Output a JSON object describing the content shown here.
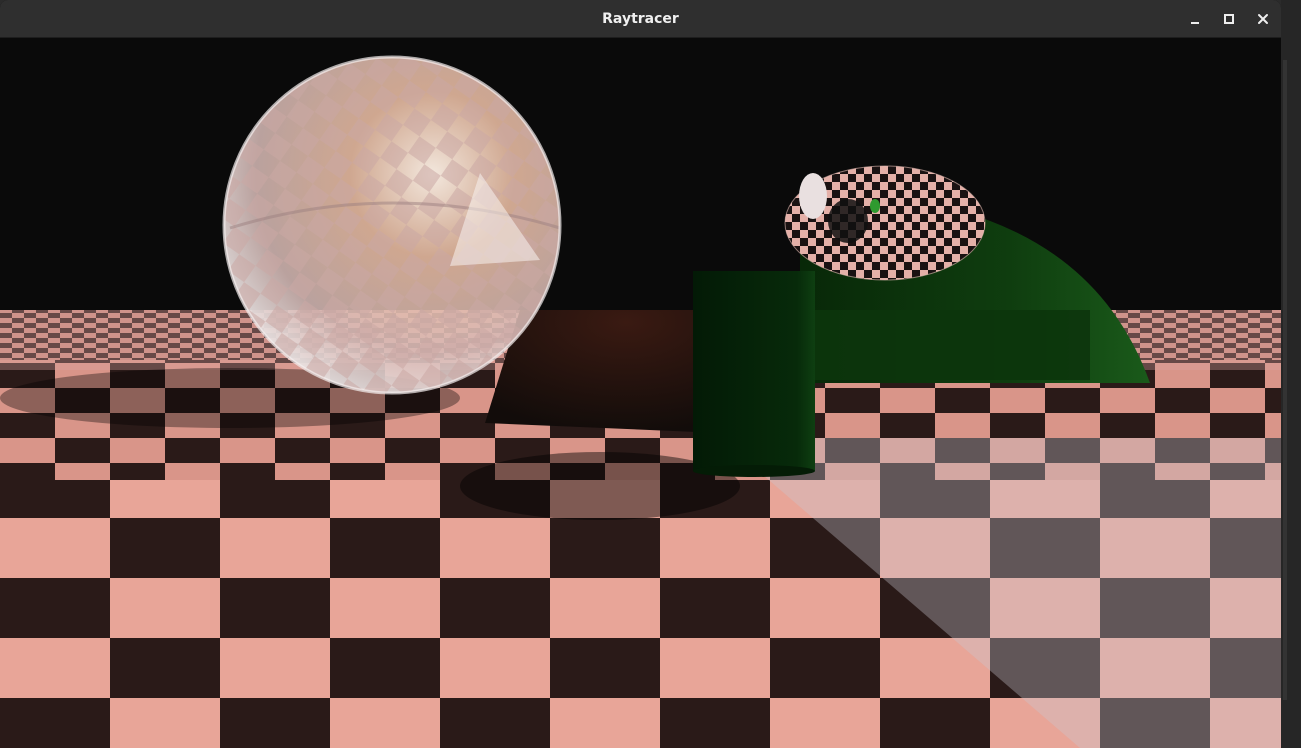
{
  "window": {
    "title": "Raytracer"
  },
  "titlebar_controls": {
    "minimize": "minimize-icon",
    "maximize": "maximize-icon",
    "close": "close-icon"
  },
  "scene": {
    "floor_light": "#e8a598",
    "floor_dark": "#2a1a18",
    "background": "#0a0a0a",
    "sphere_tint": "#f1d7d0",
    "green_object": "#0f3d0f"
  }
}
